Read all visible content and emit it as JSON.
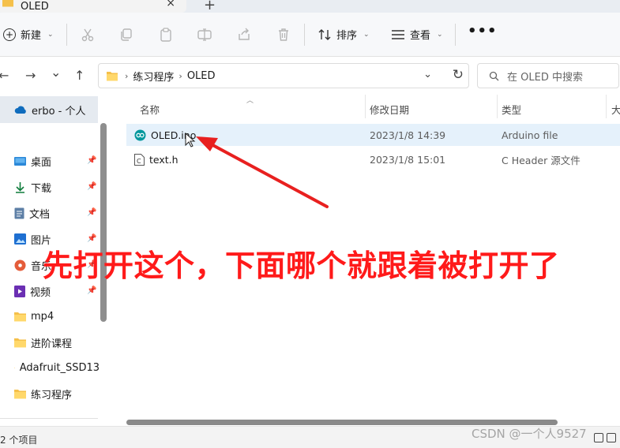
{
  "window": {
    "tab_title": "OLED",
    "tab_close": "×",
    "tab_add": "+"
  },
  "toolbar": {
    "new_label": "新建",
    "sort_label": "排序",
    "view_label": "查看",
    "more_label": "•••"
  },
  "address_bar": {
    "back": "←",
    "forward": "→",
    "up_history": "⌄",
    "up": "↑",
    "breadcrumbs": [
      "练习程序",
      "OLED"
    ],
    "search_placeholder": "在 OLED 中搜索"
  },
  "sidebar": {
    "home_label": "erbo - 个人",
    "items": [
      {
        "label": "桌面",
        "icon": "desktop-icon",
        "pinned": true
      },
      {
        "label": "下载",
        "icon": "download-icon",
        "pinned": true
      },
      {
        "label": "文档",
        "icon": "documents-icon",
        "pinned": true
      },
      {
        "label": "图片",
        "icon": "pictures-icon",
        "pinned": true
      },
      {
        "label": "音乐",
        "icon": "music-icon",
        "pinned": true
      },
      {
        "label": "视频",
        "icon": "videos-icon",
        "pinned": true
      },
      {
        "label": "mp4",
        "icon": "folder-icon",
        "pinned": false
      },
      {
        "label": "进阶课程",
        "icon": "folder-icon",
        "pinned": false
      },
      {
        "label": "Adafruit_SSD13",
        "icon": "folder-icon",
        "pinned": false
      },
      {
        "label": "练习程序",
        "icon": "folder-icon",
        "pinned": false
      }
    ]
  },
  "file_list": {
    "columns": [
      "名称",
      "修改日期",
      "类型",
      "大"
    ],
    "rows": [
      {
        "name": "OLED.ino",
        "date": "2023/1/8 14:39",
        "type": "Arduino file",
        "icon": "arduino-icon",
        "selected": true
      },
      {
        "name": "text.h",
        "date": "2023/1/8 15:01",
        "type": "C Header 源文件",
        "icon": "c-header-icon",
        "selected": false
      }
    ]
  },
  "status": {
    "item_count": "2 个项目"
  },
  "annotation": {
    "text": "先打开这个，下面哪个就跟着被打开了",
    "color": "#ff1a1a"
  },
  "watermark": "CSDN @一个人9527",
  "colors": {
    "selection": "#e5f1fb",
    "annotation_red": "#ff1a1a",
    "arduino_teal": "#00979d"
  }
}
